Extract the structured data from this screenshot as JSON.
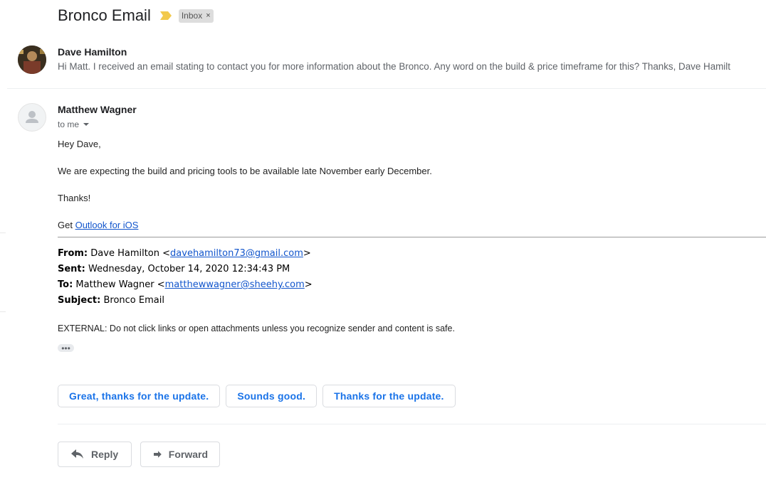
{
  "thread": {
    "subject": "Bronco Email",
    "label": "Inbox",
    "label_remove": "×"
  },
  "messages": [
    {
      "sender": "Dave Hamilton",
      "snippet": "Hi Matt. I received an email stating to contact you for more information about the Bronco. Any word on the build & price timeframe for this? Thanks, Dave Hamilt"
    },
    {
      "sender": "Matthew Wagner",
      "recipient": "to me",
      "greeting": "Hey Dave,",
      "body": "We are expecting the build and pricing tools to be available late November early December.",
      "signoff": "Thanks!",
      "get_prefix": "Get ",
      "get_link": "Outlook for iOS",
      "forwarded": {
        "from_label": "From:",
        "from_name": " Dave Hamilton <",
        "from_email": "davehamilton73@gmail.com",
        "from_close": ">",
        "sent_label": "Sent:",
        "sent_value": " Wednesday, October 14, 2020 12:34:43 PM",
        "to_label": "To:",
        "to_name": " Matthew Wagner <",
        "to_email": "matthewwagner@sheehy.com",
        "to_close": ">",
        "subject_label": "Subject:",
        "subject_value": " Bronco Email"
      },
      "external_notice": "EXTERNAL: Do not click links or open attachments unless you recognize sender and content is safe.",
      "trimmed_indicator": "•••"
    }
  ],
  "smart_replies": [
    "Great, thanks for the update.",
    "Sounds good.",
    "Thanks for the update."
  ],
  "actions": {
    "reply": "Reply",
    "forward": "Forward"
  },
  "colors": {
    "accent": "#1a73e8",
    "importance": "#f2c94c",
    "link": "#1155cc"
  }
}
